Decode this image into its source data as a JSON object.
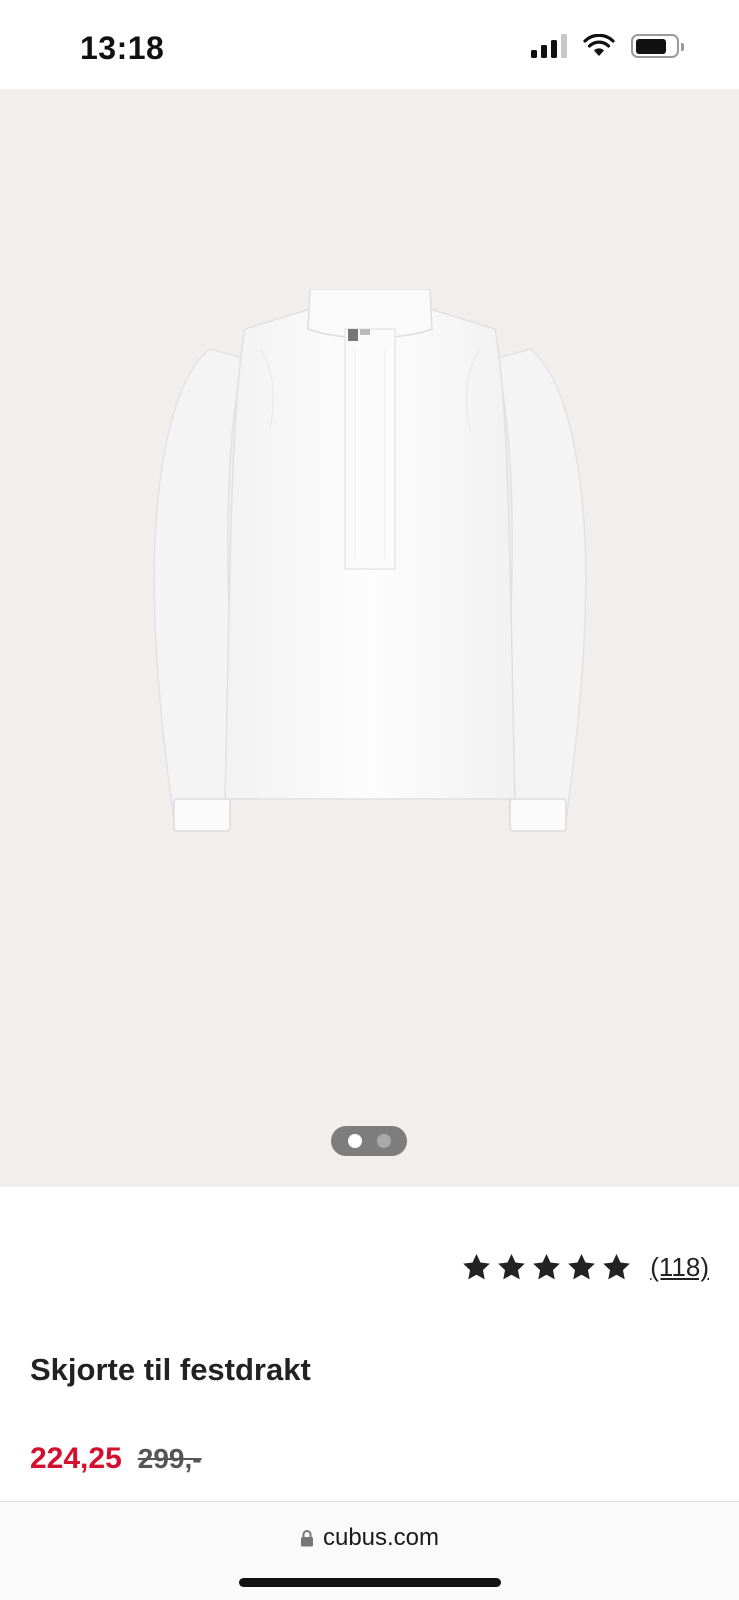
{
  "status_bar": {
    "time": "13:18",
    "icons": [
      "signal-icon",
      "wifi-icon",
      "battery-icon"
    ]
  },
  "gallery": {
    "image": "white-shirt-product-photo",
    "pages": 2,
    "active_page": 1
  },
  "product": {
    "rating": {
      "stars": 5,
      "review_count": "(118)"
    },
    "title": "Skjorte til festdrakt",
    "price_sale": "224,25",
    "price_original": "299,-"
  },
  "browser": {
    "url": "cubus.com"
  },
  "colors": {
    "sale": "#d3102f",
    "gallery_bg": "#f0efee"
  }
}
